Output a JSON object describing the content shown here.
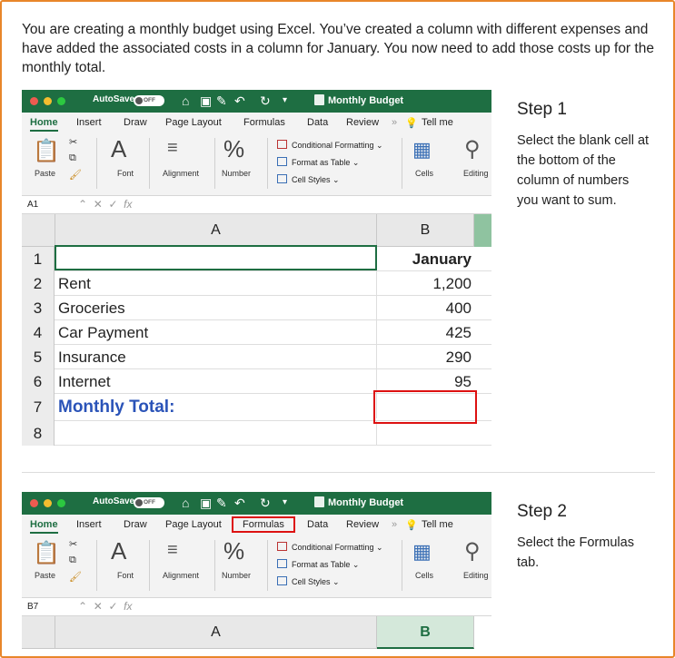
{
  "intro": "You are creating a monthly budget using Excel. You’ve created a column with different expenses and have added the associated costs in a column for January. You now need to add those costs up for the monthly total.",
  "excel": {
    "autosave_label": "AutoSave",
    "autosave_state": "OFF",
    "doc_title": "Monthly Budget",
    "tabs": [
      "Home",
      "Insert",
      "Draw",
      "Page Layout",
      "Formulas",
      "Data",
      "Review",
      "Tell me"
    ],
    "ribbon": {
      "paste": "Paste",
      "font": "Font",
      "alignment": "Alignment",
      "number": "Number",
      "conditional_formatting": "Conditional Formatting",
      "format_as_table": "Format as Table",
      "cell_styles": "Cell Styles",
      "cells": "Cells",
      "editing": "Editing"
    },
    "fx": "fx",
    "col_a": "A",
    "col_b": "B"
  },
  "step1": {
    "title": "Step 1",
    "desc": "Select the blank cell at the bottom of the column of numbers you want to sum.",
    "name_box": "A1",
    "rows": [
      {
        "num": "1",
        "a": "",
        "b": "January"
      },
      {
        "num": "2",
        "a": "Rent",
        "b": "1,200"
      },
      {
        "num": "3",
        "a": "Groceries",
        "b": "400"
      },
      {
        "num": "4",
        "a": "Car Payment",
        "b": "425"
      },
      {
        "num": "5",
        "a": "Insurance",
        "b": "290"
      },
      {
        "num": "6",
        "a": "Internet",
        "b": "95"
      },
      {
        "num": "7",
        "a": "Monthly Total:",
        "b": ""
      },
      {
        "num": "8",
        "a": "",
        "b": ""
      }
    ]
  },
  "step2": {
    "title": "Step 2",
    "desc": "Select the Formulas tab.",
    "name_box": "B7"
  },
  "colors": {
    "excel_green": "#1e6e42",
    "highlight_red": "#dd1111",
    "total_blue": "#2a53b8",
    "border_orange": "#e8862a"
  }
}
